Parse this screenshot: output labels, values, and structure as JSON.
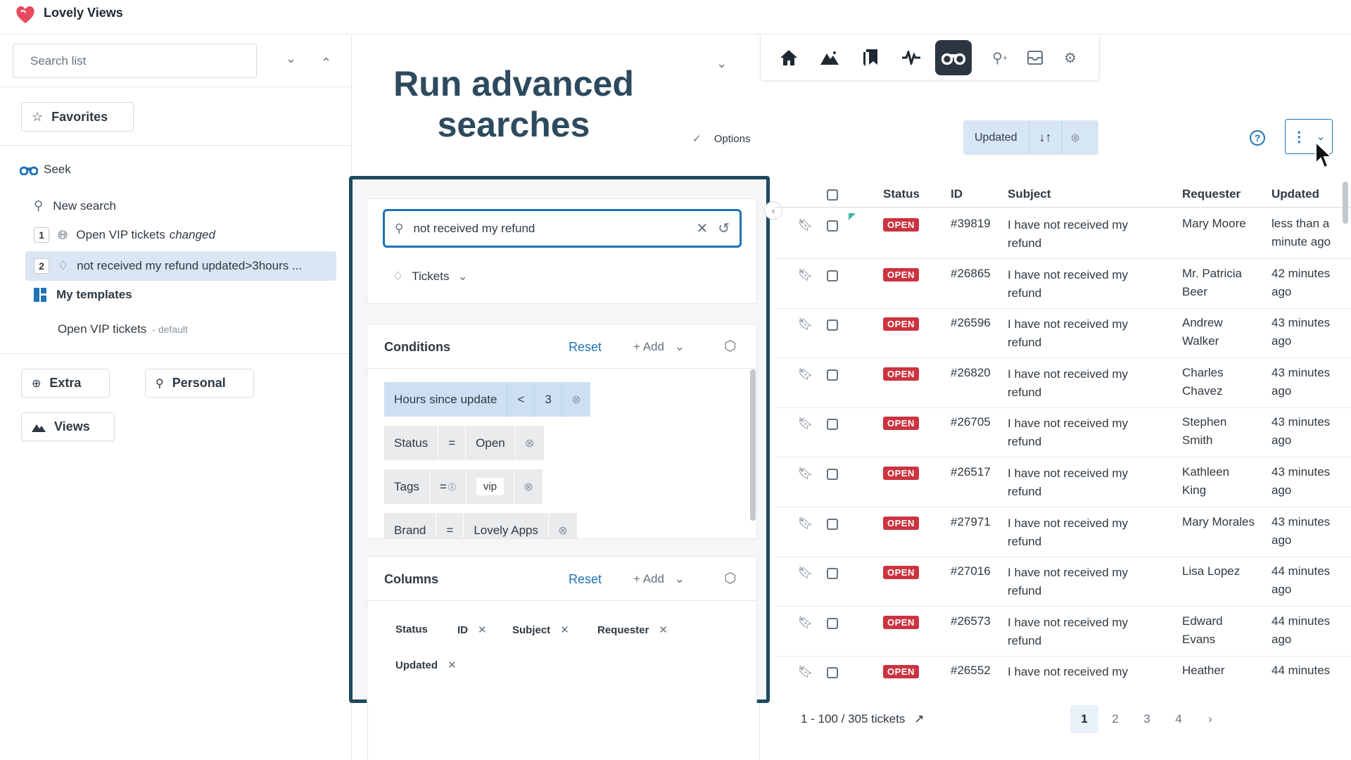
{
  "app": {
    "name": "Lovely Views"
  },
  "sidebar": {
    "search_placeholder": "Search list",
    "favorites_label": "Favorites",
    "seek_label": "Seek",
    "new_search_label": "New search",
    "items": [
      {
        "num": "1",
        "label": "Open VIP tickets",
        "suffix": "changed"
      },
      {
        "num": "2",
        "label": "not received my refund updated>3hours ..."
      }
    ],
    "templates_label": "My templates",
    "template_item": "Open VIP tickets",
    "template_default": "- default",
    "extra_label": "Extra",
    "personal_label": "Personal",
    "views_label": "Views"
  },
  "main": {
    "title_line1": "Run advanced",
    "title_line2": "searches",
    "options_label": "Options"
  },
  "sort": {
    "label": "Updated"
  },
  "panel": {
    "search_value": "not received my refund",
    "type_label": "Tickets",
    "conditions_title": "Conditions",
    "reset_label": "Reset",
    "add_label": "+ Add",
    "conditions": [
      {
        "field": "Hours since update",
        "op": "<",
        "value": "3"
      },
      {
        "field": "Status",
        "op": "=",
        "value": "Open"
      },
      {
        "field": "Tags",
        "op": "=",
        "value": "vip"
      },
      {
        "field": "Brand",
        "op": "=",
        "value": "Lovely Apps"
      }
    ],
    "columns_title": "Columns",
    "columns": [
      "Status",
      "ID",
      "Subject",
      "Requester",
      "Updated"
    ]
  },
  "table": {
    "headers": {
      "status": "Status",
      "id": "ID",
      "subject": "Subject",
      "requester": "Requester",
      "updated": "Updated"
    },
    "rows": [
      {
        "status": "OPEN",
        "id": "#39819",
        "subject1": "I have not received my",
        "subject2": "refund",
        "req1": "Mary Moore",
        "req2": "",
        "upd1": "less than a",
        "upd2": "minute ago"
      },
      {
        "status": "OPEN",
        "id": "#26865",
        "subject1": "I have not received my",
        "subject2": "refund",
        "req1": "Mr. Patricia",
        "req2": "Beer",
        "upd1": "42 minutes",
        "upd2": "ago"
      },
      {
        "status": "OPEN",
        "id": "#26596",
        "subject1": "I have not received my",
        "subject2": "refund",
        "req1": "Andrew",
        "req2": "Walker",
        "upd1": "43 minutes",
        "upd2": "ago"
      },
      {
        "status": "OPEN",
        "id": "#26820",
        "subject1": "I have not received my",
        "subject2": "refund",
        "req1": "Charles",
        "req2": "Chavez",
        "upd1": "43 minutes",
        "upd2": "ago"
      },
      {
        "status": "OPEN",
        "id": "#26705",
        "subject1": "I have not received my",
        "subject2": "refund",
        "req1": "Stephen",
        "req2": "Smith",
        "upd1": "43 minutes",
        "upd2": "ago"
      },
      {
        "status": "OPEN",
        "id": "#26517",
        "subject1": "I have not received my",
        "subject2": "refund",
        "req1": "Kathleen",
        "req2": "King",
        "upd1": "43 minutes",
        "upd2": "ago"
      },
      {
        "status": "OPEN",
        "id": "#27971",
        "subject1": "I have not received my",
        "subject2": "refund",
        "req1": "Mary Morales",
        "req2": "",
        "upd1": "43 minutes",
        "upd2": "ago"
      },
      {
        "status": "OPEN",
        "id": "#27016",
        "subject1": "I have not received my",
        "subject2": "refund",
        "req1": "Lisa Lopez",
        "req2": "",
        "upd1": "44 minutes",
        "upd2": "ago"
      },
      {
        "status": "OPEN",
        "id": "#26573",
        "subject1": "I have not received my",
        "subject2": "refund",
        "req1": "Edward",
        "req2": "Evans",
        "upd1": "44 minutes",
        "upd2": "ago"
      },
      {
        "status": "OPEN",
        "id": "#26552",
        "subject1": "I have not received my",
        "subject2": "",
        "req1": "Heather",
        "req2": "",
        "upd1": "44 minutes",
        "upd2": ""
      }
    ],
    "count_label": "1 - 100 / 305 tickets",
    "pages": [
      "1",
      "2",
      "3",
      "4"
    ]
  },
  "colors": {
    "accent": "#1f73b7",
    "badge_open": "#cc3340",
    "panel_border": "#1f4a5e",
    "title": "#2d4a5e"
  },
  "icons": [
    "heart-logo-icon",
    "chevron-down-icon",
    "chevron-up-icon",
    "star-icon",
    "binoculars-icon",
    "search-plus-icon",
    "globe-icon",
    "tag-icon",
    "templates-icon",
    "plus-circle-icon",
    "user-icon",
    "mountain-icon",
    "home-icon",
    "bookmarks-icon",
    "activity-icon",
    "inbox-icon",
    "gear-icon",
    "check-icon",
    "sort-icon",
    "close-circle-icon",
    "help-icon",
    "more-icon",
    "search-icon",
    "clear-icon",
    "history-icon",
    "cube-icon",
    "bookmark-icon",
    "external-link-icon",
    "chevron-right-icon"
  ]
}
